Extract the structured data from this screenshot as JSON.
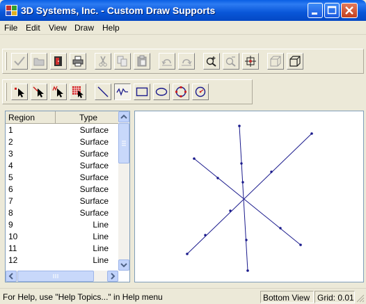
{
  "window": {
    "title": "3D Systems, Inc. - Custom Draw Supports"
  },
  "menu": [
    {
      "label": "File"
    },
    {
      "label": "Edit"
    },
    {
      "label": "View"
    },
    {
      "label": "Draw"
    },
    {
      "label": "Help"
    }
  ],
  "list": {
    "headers": {
      "region": "Region",
      "type": "Type"
    },
    "rows": [
      {
        "region": "1",
        "type": "Surface"
      },
      {
        "region": "2",
        "type": "Surface"
      },
      {
        "region": "3",
        "type": "Surface"
      },
      {
        "region": "4",
        "type": "Surface"
      },
      {
        "region": "5",
        "type": "Surface"
      },
      {
        "region": "6",
        "type": "Surface"
      },
      {
        "region": "7",
        "type": "Surface"
      },
      {
        "region": "8",
        "type": "Surface"
      },
      {
        "region": "9",
        "type": "Line"
      },
      {
        "region": "10",
        "type": "Line"
      },
      {
        "region": "11",
        "type": "Line"
      },
      {
        "region": "12",
        "type": "Line"
      }
    ]
  },
  "status": {
    "help": "For Help, use \"Help Topics...\" in Help menu",
    "view": "Bottom View",
    "grid": "Grid: 0.01"
  },
  "colors": {
    "accent": "#0A5FE4",
    "drawing": "#1A1A8C"
  }
}
